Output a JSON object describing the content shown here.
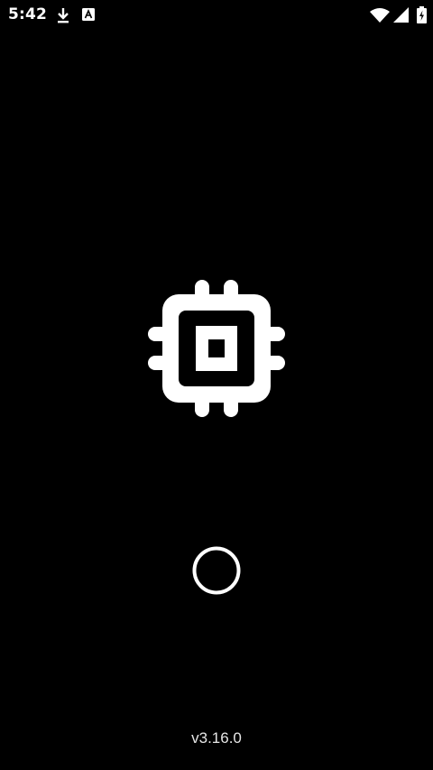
{
  "status_bar": {
    "time": "5:42",
    "icons": [
      "download-icon",
      "a-letter-notification-icon",
      "wifi-icon",
      "cell-signal-icon",
      "battery-charging-icon"
    ]
  },
  "splash": {
    "logo_icon": "cpu-chip-icon",
    "spinner_icon": "loading-ring-icon",
    "version": "v3.16.0"
  },
  "colors": {
    "background": "#000000",
    "foreground": "#ffffff"
  }
}
